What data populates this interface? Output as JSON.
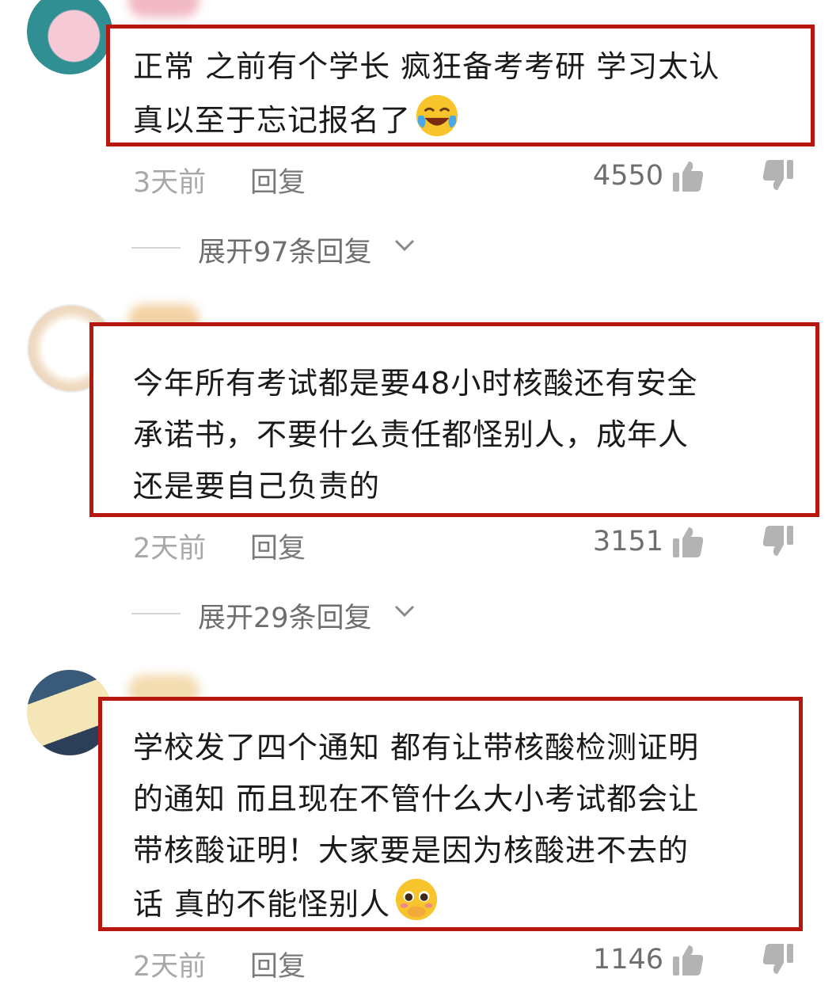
{
  "comments": [
    {
      "lines": [
        "正常 之前有个学长 疯狂备考考研 学习太认",
        "真以至于忘记报名了"
      ],
      "emoji": "laughing-tears-emoji",
      "time": "3天前",
      "reply": "回复",
      "likes": "4550",
      "expand": "展开97条回复"
    },
    {
      "lines": [
        "今年所有考试都是要48小时核酸还有安全",
        "承诺书，不要什么责任都怪别人，成年人",
        "还是要自己负责的"
      ],
      "time": "2天前",
      "reply": "回复",
      "likes": "3151",
      "expand": "展开29条回复"
    },
    {
      "lines": [
        "学校发了四个通知 都有让带核酸检测证明",
        "的通知 而且现在不管什么大小考试都会让",
        "带核酸证明！大家要是因为核酸进不去的",
        "话 真的不能怪别人"
      ],
      "emoji": "pleading-face-emoji",
      "time": "2天前",
      "reply": "回复",
      "likes": "1146"
    }
  ],
  "colors": {
    "highlight_border": "#b7170f",
    "text": "#1a1a1a",
    "meta": "#a8a8a8"
  }
}
